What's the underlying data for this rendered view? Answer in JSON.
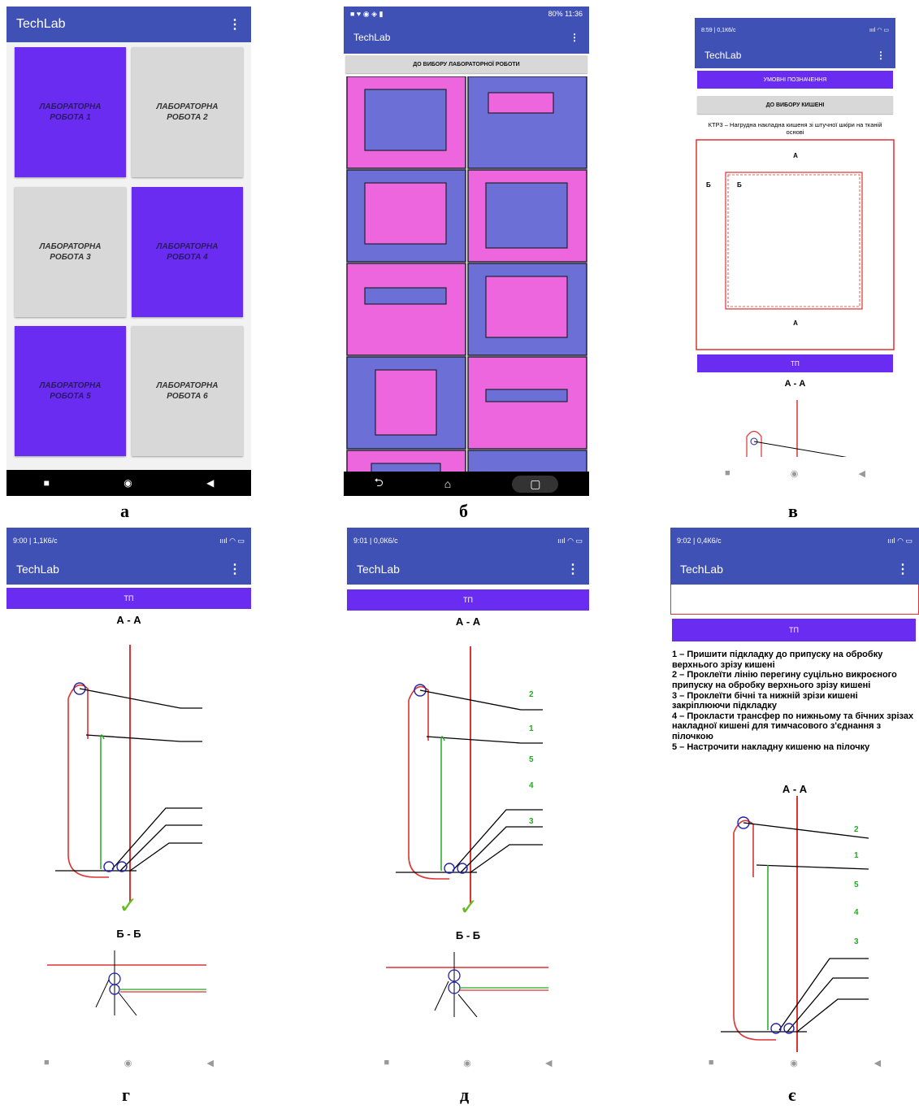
{
  "app_title": "TechLab",
  "panel_a": {
    "caption": "а",
    "tiles": [
      {
        "line1": "ЛАБОРАТОРНА",
        "line2": "РОБОТА 1"
      },
      {
        "line1": "ЛАБОРАТОРНА",
        "line2": "РОБОТА 2"
      },
      {
        "line1": "ЛАБОРАТОРНА",
        "line2": "РОБОТА 3"
      },
      {
        "line1": "ЛАБОРАТОРНА",
        "line2": "РОБОТА 4"
      },
      {
        "line1": "ЛАБОРАТОРНА",
        "line2": "РОБОТА 5"
      },
      {
        "line1": "ЛАБОРАТОРНА",
        "line2": "РОБОТА 6"
      }
    ]
  },
  "panel_b": {
    "caption": "б",
    "status_right": "80% 11:36",
    "back_button": "ДО ВИБОРУ ЛАБОРАТОРНОЇ РОБОТИ"
  },
  "panel_c": {
    "caption": "в",
    "status_left": "8:59 | 0,1К6/с",
    "btn_symbols": "УМОВНІ ПОЗНАЧЕННЯ",
    "btn_back": "ДО ВИБОРУ КИШЕНІ",
    "description": "КТР3 – Нагрудна накладна кишеня зі штучної шкіри на тканій основі",
    "btn_tp": "ТП",
    "section": "А - А",
    "mark_a": "А",
    "mark_b": "Б"
  },
  "panel_g": {
    "caption": "г",
    "status_left": "9:00 | 1,1К6/с",
    "btn_tp": "ТП",
    "section1": "А - А",
    "section2": "Б - Б"
  },
  "panel_d": {
    "caption": "д",
    "status_left": "9:01 | 0,0К6/с",
    "btn_tp": "ТП",
    "section1": "А - А",
    "section2": "Б - Б",
    "labels": [
      "2",
      "1",
      "5",
      "4",
      "3"
    ]
  },
  "panel_e": {
    "caption": "є",
    "status_left": "9:02 | 0,4К6/с",
    "btn_tp": "ТП",
    "steps": [
      "1 – Пришити підкладку до припуску на обробку верхнього зрізу кишені",
      "2 – Проклеїти лінію перегину суцільно викроєного припуску на обробку верхнього зрізу кишені",
      "3 – Проклеїти бічні та нижній зрізи кишені закріплюючи підкладку",
      "4 – Прокласти трансфер по нижньому та бічних зрізах накладної кишені для тимчасового з'єднання з пілочкою",
      "5 – Настрочити накладну кишеню на пілочку"
    ],
    "section": "А - А",
    "labels": [
      "2",
      "1",
      "5",
      "4",
      "3"
    ]
  }
}
